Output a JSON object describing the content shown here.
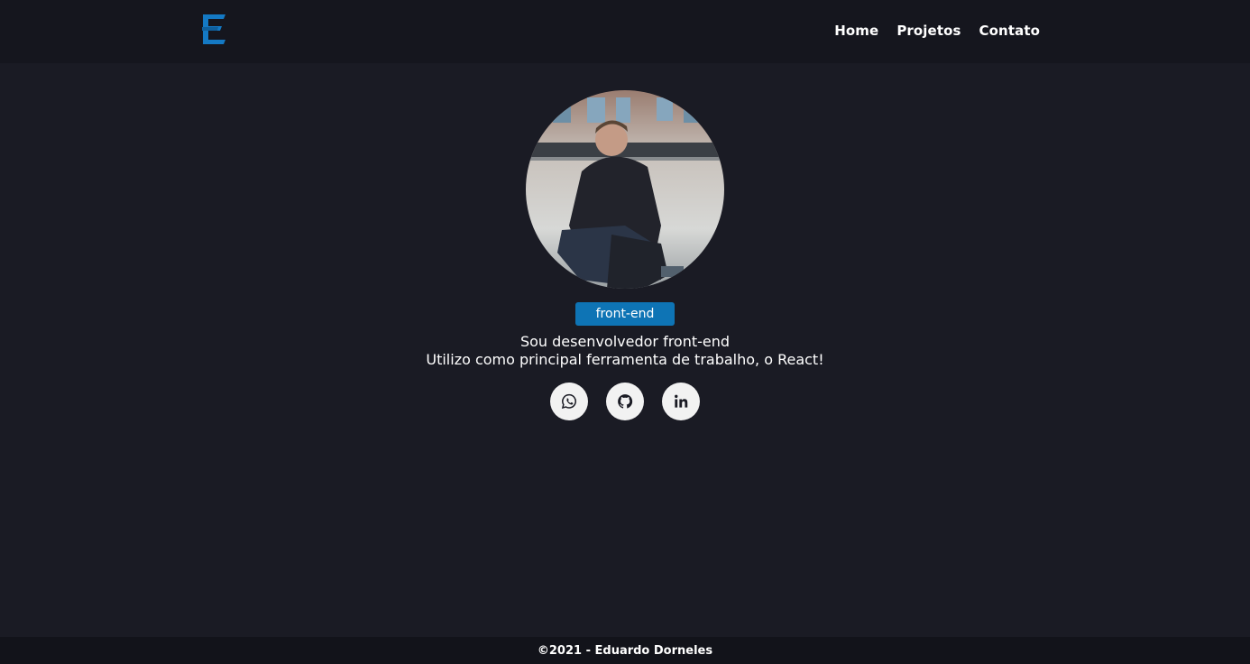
{
  "header": {
    "logo_icon": "e-logo-icon",
    "nav": [
      {
        "label": "Home"
      },
      {
        "label": "Projetos"
      },
      {
        "label": "Contato"
      }
    ]
  },
  "profile": {
    "avatar_icon": "profile-photo",
    "badge": "front-end",
    "bio_line1": "Sou desenvolvedor front-end",
    "bio_line2": "Utilizo como principal ferramenta de trabalho, o React!"
  },
  "socials": [
    {
      "icon": "whatsapp-icon"
    },
    {
      "icon": "github-icon"
    },
    {
      "icon": "linkedin-icon"
    }
  ],
  "footer": {
    "text": "©2021 - Eduardo Dorneles"
  },
  "colors": {
    "background": "#1a1b24",
    "header": "#15161e",
    "accent": "#0e74b5",
    "footer": "#12131a"
  }
}
